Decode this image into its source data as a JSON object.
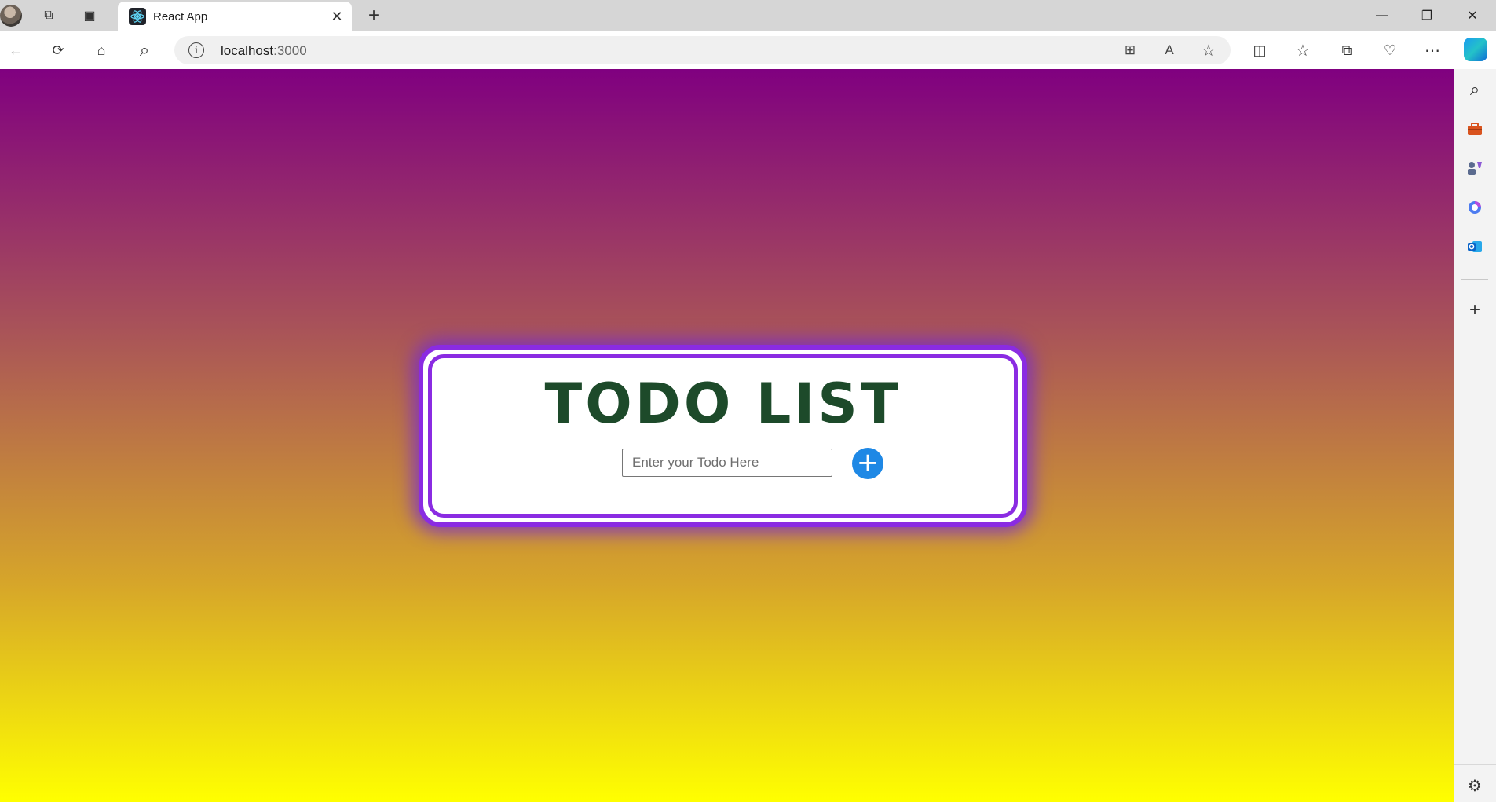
{
  "browser": {
    "tab": {
      "title": "React App",
      "close_glyph": "✕"
    },
    "new_tab_glyph": "+",
    "window_controls": {
      "minimize": "—",
      "restore": "❐",
      "close": "✕"
    },
    "address": {
      "host": "localhost",
      "port": ":3000"
    },
    "icons": {
      "back": "←",
      "refresh": "⟳",
      "home": "⌂",
      "search": "⌕",
      "info": "i",
      "apps": "⊞",
      "read_aloud": "A",
      "favorite": "☆",
      "split": "◫",
      "favorites": "☆",
      "collections": "⧉",
      "health": "♡",
      "more": "⋯",
      "workspaces": "⧉",
      "tab_actions": "▣"
    }
  },
  "sidebar": {
    "icons": [
      "search-icon",
      "toolbox-icon",
      "games-icon",
      "office-icon",
      "outlook-icon",
      "add-icon",
      "settings-icon"
    ],
    "glyphs": {
      "search": "⌕",
      "add": "+",
      "settings": "⚙"
    }
  },
  "app": {
    "title": "TODO LIST",
    "input_placeholder": "Enter your Todo Here",
    "input_value": "",
    "add_glyph": "+"
  },
  "colors": {
    "gradient_top": "#800080",
    "gradient_bottom": "#ffff00",
    "card_border": "#8a2be2",
    "title": "#1d4a2a",
    "add_button": "#1e88e5"
  }
}
